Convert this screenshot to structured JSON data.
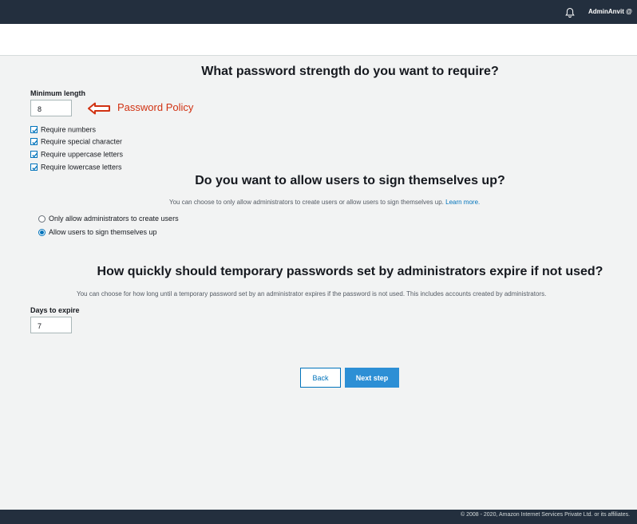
{
  "header": {
    "user_label": "AdminAnvit @",
    "icons": [
      "bell-icon"
    ]
  },
  "password": {
    "heading": "What password strength do you want to require?",
    "min_length_label": "Minimum length",
    "min_length_value": "8",
    "annotation": "Password Policy",
    "requirements": [
      {
        "label": "Require numbers",
        "checked": true
      },
      {
        "label": "Require special character",
        "checked": true
      },
      {
        "label": "Require uppercase letters",
        "checked": true
      },
      {
        "label": "Require lowercase letters",
        "checked": true
      }
    ]
  },
  "signup": {
    "heading": "Do you want to allow users to sign themselves up?",
    "description": "You can choose to only allow administrators to create users or allow users to sign themselves up.",
    "learn_more": "Learn more.",
    "options": [
      {
        "label": "Only allow administrators to create users",
        "selected": false
      },
      {
        "label": "Allow users to sign themselves up",
        "selected": true
      }
    ]
  },
  "expiry": {
    "heading": "How quickly should temporary passwords set by administrators expire if not used?",
    "description": "You can choose for how long until a temporary password set by an administrator expires if the password is not used. This includes accounts created by administrators.",
    "days_label": "Days to expire",
    "days_value": "7"
  },
  "actions": {
    "back_label": "Back",
    "next_label": "Next step"
  },
  "footer": {
    "copyright": "© 2008 - 2020, Amazon Internet Services Private Ltd. or its affiliates."
  },
  "colors": {
    "header_bg": "#232f3e",
    "accent": "#0073bb",
    "primary_button": "#2d8fd5",
    "annotation": "#d13212"
  }
}
